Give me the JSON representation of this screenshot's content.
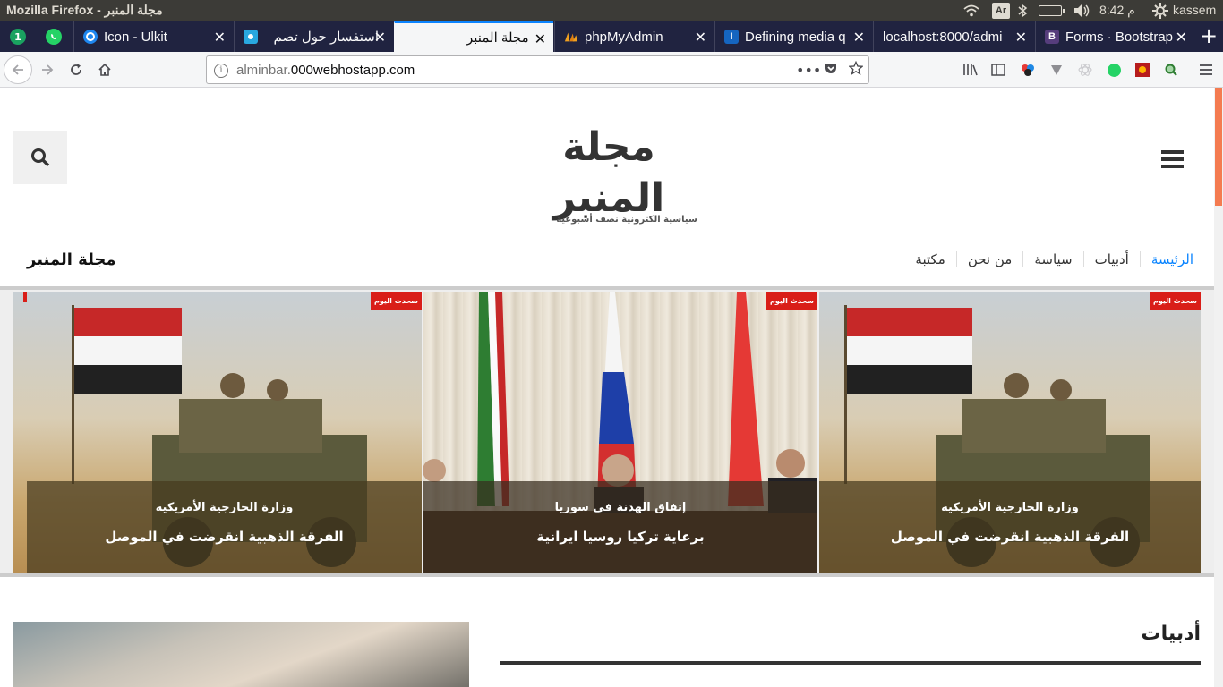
{
  "system_bar": {
    "window_title": "Mozilla Firefox - مجلة المنبر",
    "keyboard_layout": "Ar",
    "time": "8:42 م",
    "user": "kassem"
  },
  "tabs": {
    "pinned": [
      {
        "name": "gmail-notifier",
        "badge": "1"
      },
      {
        "name": "whatsapp"
      }
    ],
    "items": [
      {
        "label": "Icon - Ulkit",
        "favicon": "ulkit-icon",
        "active": false
      },
      {
        "label": "استفسار حول تصم",
        "favicon": "generic-icon",
        "active": false
      },
      {
        "label": "مجلة المنبر",
        "favicon": "none",
        "active": true
      },
      {
        "label": "phpMyAdmin",
        "favicon": "phpmyadmin-icon",
        "active": false
      },
      {
        "label": "Defining media q",
        "favicon": "I-icon",
        "active": false
      },
      {
        "label": "localhost:8000/admi",
        "favicon": "none",
        "active": false
      },
      {
        "label": "Forms · Bootstrap",
        "favicon": "bootstrap-icon",
        "active": false
      }
    ],
    "close_glyph": "✕",
    "new_tab": "+"
  },
  "navbar": {
    "url_host_muted": "alminbar.",
    "url_host_main": "000webhostapp.com"
  },
  "site": {
    "logo_title": "مجلة المنبر",
    "logo_subtitle": "سياسية الكترونية نصف أسبوعية",
    "menu": [
      {
        "label": "الرئيسة",
        "active": true
      },
      {
        "label": "أدبيات",
        "active": false
      },
      {
        "label": "سياسة",
        "active": false
      },
      {
        "label": "من نحن",
        "active": false
      },
      {
        "label": "مكتبة",
        "active": false
      }
    ],
    "site_name": "مجلة المنبر"
  },
  "slider": {
    "badge": "سحدث اليوم",
    "slides": [
      {
        "scene": "desert",
        "kicker": "وزارة الخارجية الأمريكيه",
        "headline": "الفرقة الذهبية انقرضت في الموصل"
      },
      {
        "scene": "conference",
        "kicker": "إتفاق الهدنة في سوريا",
        "headline": "برعاية تركيا روسيا ايرانية"
      },
      {
        "scene": "desert",
        "kicker": "وزارة الخارجية الأمريكيه",
        "headline": "الفرقة الذهبية انقرضت في الموصل"
      }
    ]
  },
  "section": {
    "title": "أدبيات"
  },
  "colors": {
    "accent": "#0a84ff",
    "tab_strip": "#202340",
    "scroll_thumb": "#f47b50",
    "badge": "#d91e18"
  }
}
